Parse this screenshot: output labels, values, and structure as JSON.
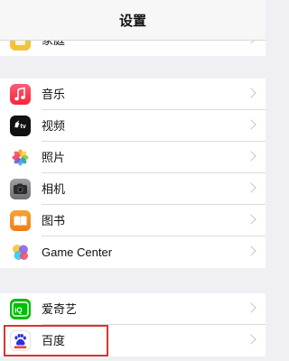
{
  "header": {
    "title": "设置"
  },
  "group_top": {
    "items": [
      {
        "label": "家庭",
        "icon": "family-icon"
      }
    ]
  },
  "group_media": {
    "items": [
      {
        "label": "音乐",
        "icon": "music-icon",
        "color": "#fc3c44"
      },
      {
        "label": "视频",
        "icon": "tv-icon",
        "color": "#111111"
      },
      {
        "label": "照片",
        "icon": "photos-icon"
      },
      {
        "label": "相机",
        "icon": "camera-icon",
        "color": "#8e8e93"
      },
      {
        "label": "图书",
        "icon": "books-icon",
        "color": "#f39c12"
      },
      {
        "label": "Game Center",
        "icon": "game-center-icon"
      }
    ]
  },
  "group_apps": {
    "items": [
      {
        "label": "爱奇艺",
        "icon": "iqiyi-icon",
        "color": "#00be06"
      },
      {
        "label": "百度",
        "icon": "baidu-icon",
        "color": "#2932e1"
      }
    ]
  }
}
